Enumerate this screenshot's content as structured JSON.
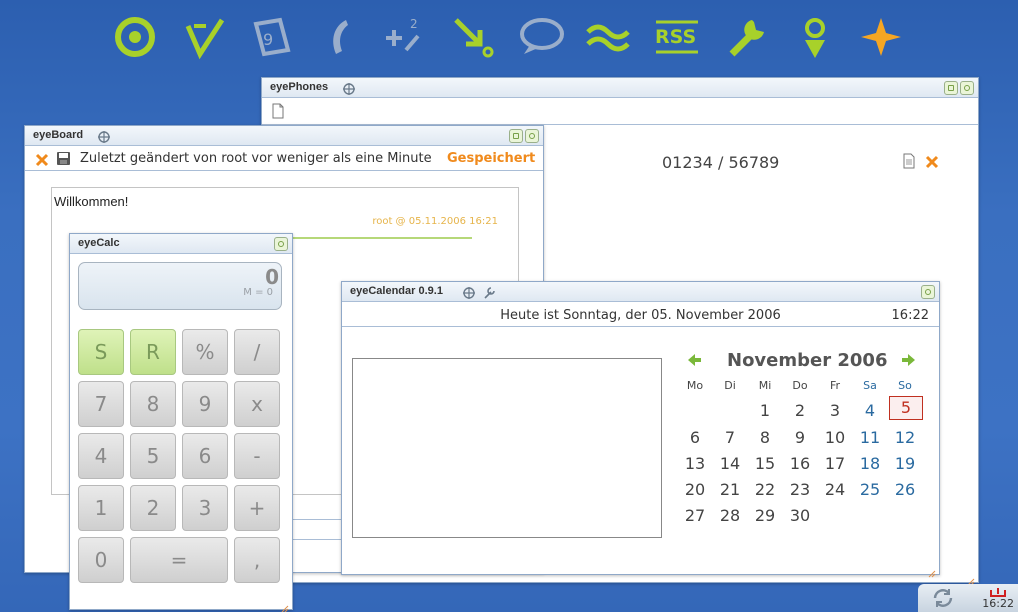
{
  "dock": {
    "items": [
      "eye-icon",
      "edit-check-icon",
      "calendar-tag-icon",
      "phone-icon",
      "calculator-icon",
      "download-icon",
      "chat-bubble-icon",
      "wave-icon",
      "rss-icon",
      "wrench-icon",
      "location-pin-icon",
      "plus-star-icon"
    ],
    "rss_label": "RSS",
    "accent": "#a8d12a"
  },
  "phones": {
    "title": "eyePhones",
    "number": "01234 / 56789"
  },
  "board": {
    "title": "eyeBoard",
    "status": "Zuletzt geändert von root vor weniger als eine Minute",
    "saved": "Gespeichert",
    "welcome": "Willkommen!",
    "meta": "root @ 05.11.2006 16:21"
  },
  "calc": {
    "title": "eyeCalc",
    "value": "0",
    "memory": "M = 0",
    "keys": [
      "S",
      "R",
      "%",
      "/",
      "7",
      "8",
      "9",
      "x",
      "4",
      "5",
      "6",
      "-",
      "1",
      "2",
      "3",
      "+",
      "0",
      "=",
      ","
    ]
  },
  "calendar": {
    "title": "eyeCalendar 0.9.1",
    "today_text": "Heute ist Sonntag, der 05. November 2006",
    "time": "16:22",
    "month": "November 2006",
    "weekdays": [
      "Mo",
      "Di",
      "Mi",
      "Do",
      "Fr",
      "Sa",
      "So"
    ],
    "days": [
      "1",
      "2",
      "3",
      "4",
      "5",
      "6",
      "7",
      "8",
      "9",
      "10",
      "11",
      "12",
      "13",
      "14",
      "15",
      "16",
      "17",
      "18",
      "19",
      "20",
      "21",
      "22",
      "23",
      "24",
      "25",
      "26",
      "27",
      "28",
      "29",
      "30"
    ],
    "first_weekday_index": 2,
    "today": "5"
  },
  "tray": {
    "time": "16:22"
  }
}
